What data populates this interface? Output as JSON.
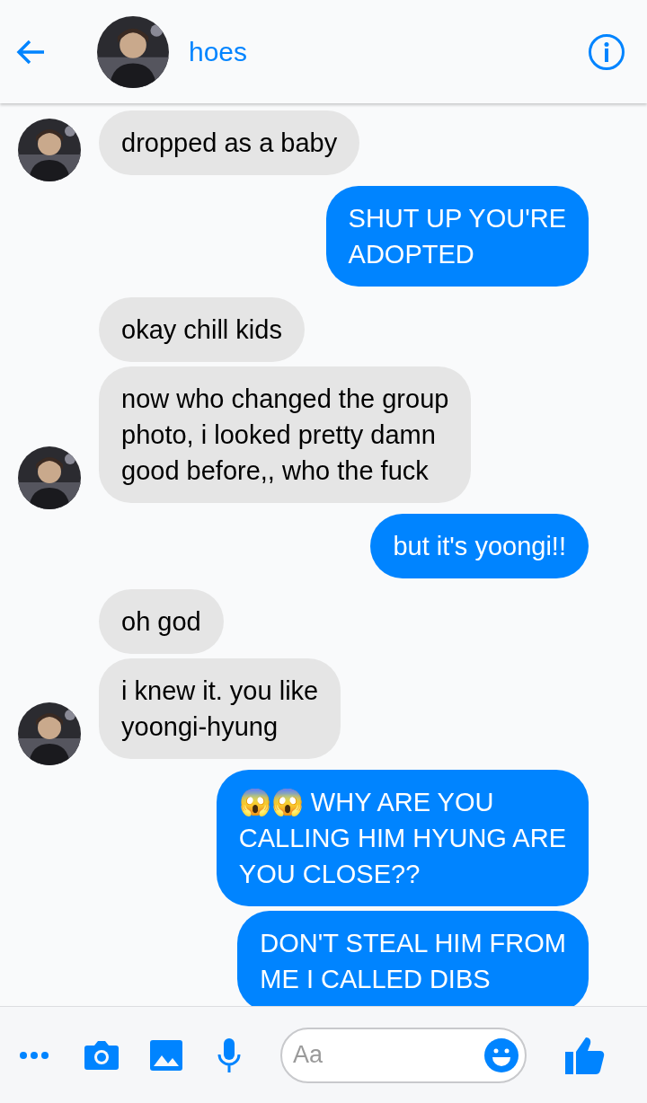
{
  "header": {
    "title": "hoes"
  },
  "messages": [
    {
      "kind": "incoming",
      "text": "dropped as a baby",
      "avatar": true
    },
    {
      "kind": "outgoing",
      "text": "SHUT UP YOU'RE\nADOPTED"
    },
    {
      "kind": "incoming",
      "text": "okay chill kids",
      "avatar": false
    },
    {
      "kind": "incoming",
      "text": "now who changed the group\nphoto, i looked pretty damn\ngood before,, who the fuck",
      "avatar": true
    },
    {
      "kind": "outgoing",
      "text": "but it's yoongi!!"
    },
    {
      "kind": "incoming",
      "text": "oh god",
      "avatar": false
    },
    {
      "kind": "incoming",
      "text": "i knew it. you like\nyoongi-hyung",
      "avatar": true
    },
    {
      "kind": "outgoing",
      "text": "😱😱 WHY ARE YOU\nCALLING HIM HYUNG ARE\nYOU CLOSE??"
    },
    {
      "kind": "outgoing",
      "text": "DON'T STEAL HIM FROM\nME I CALLED DIBS"
    }
  ],
  "composer": {
    "placeholder": "Aa"
  }
}
